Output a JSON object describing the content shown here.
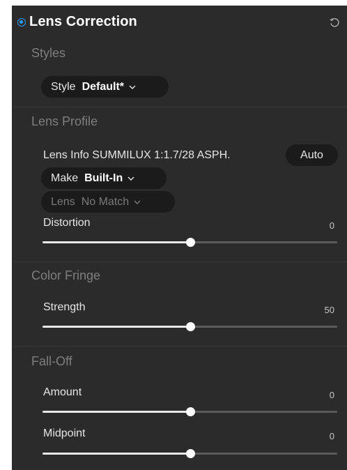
{
  "panel": {
    "title": "Lens Correction",
    "icons": {
      "power": "power-toggle-icon",
      "reset": "reset-icon"
    },
    "accent_color": "#2a9bff"
  },
  "styles": {
    "section_title": "Styles",
    "style_label": "Style",
    "style_value": "Default*"
  },
  "lens_profile": {
    "section_title": "Lens Profile",
    "lens_info": "Lens Info SUMMILUX 1:1.7/28 ASPH.",
    "auto_label": "Auto",
    "make_label": "Make",
    "make_value": "Built-In",
    "lens_label": "Lens",
    "lens_value": "No Match",
    "distortion_label": "Distortion",
    "distortion_value": "0",
    "distortion_level": 0.5
  },
  "color_fringe": {
    "section_title": "Color Fringe",
    "strength_label": "Strength",
    "strength_value": "50",
    "strength_level": 0.5
  },
  "falloff": {
    "section_title": "Fall-Off",
    "amount_label": "Amount",
    "amount_value": "0",
    "amount_level": 0.5,
    "midpoint_label": "Midpoint",
    "midpoint_value": "0",
    "midpoint_level": 0.5
  }
}
